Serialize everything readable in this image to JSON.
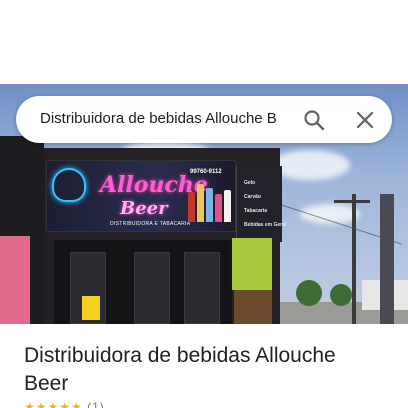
{
  "search": {
    "query": "Distribuidora de bebidas Allouche B"
  },
  "photo": {
    "sign_name": "Allouche",
    "sign_name_2": "Beer",
    "sign_subtitle": "DISTRIBUIDORA E TABACARIA",
    "sign_phone": "99760-9112",
    "side_panel": [
      "Gelo",
      "Carvão",
      "Tabacaria",
      "Bebidas em Geral"
    ]
  },
  "place": {
    "title": "Distribuidora de bebidas Allouche Beer",
    "stars": "★★★★★",
    "review_count": "(1)"
  }
}
